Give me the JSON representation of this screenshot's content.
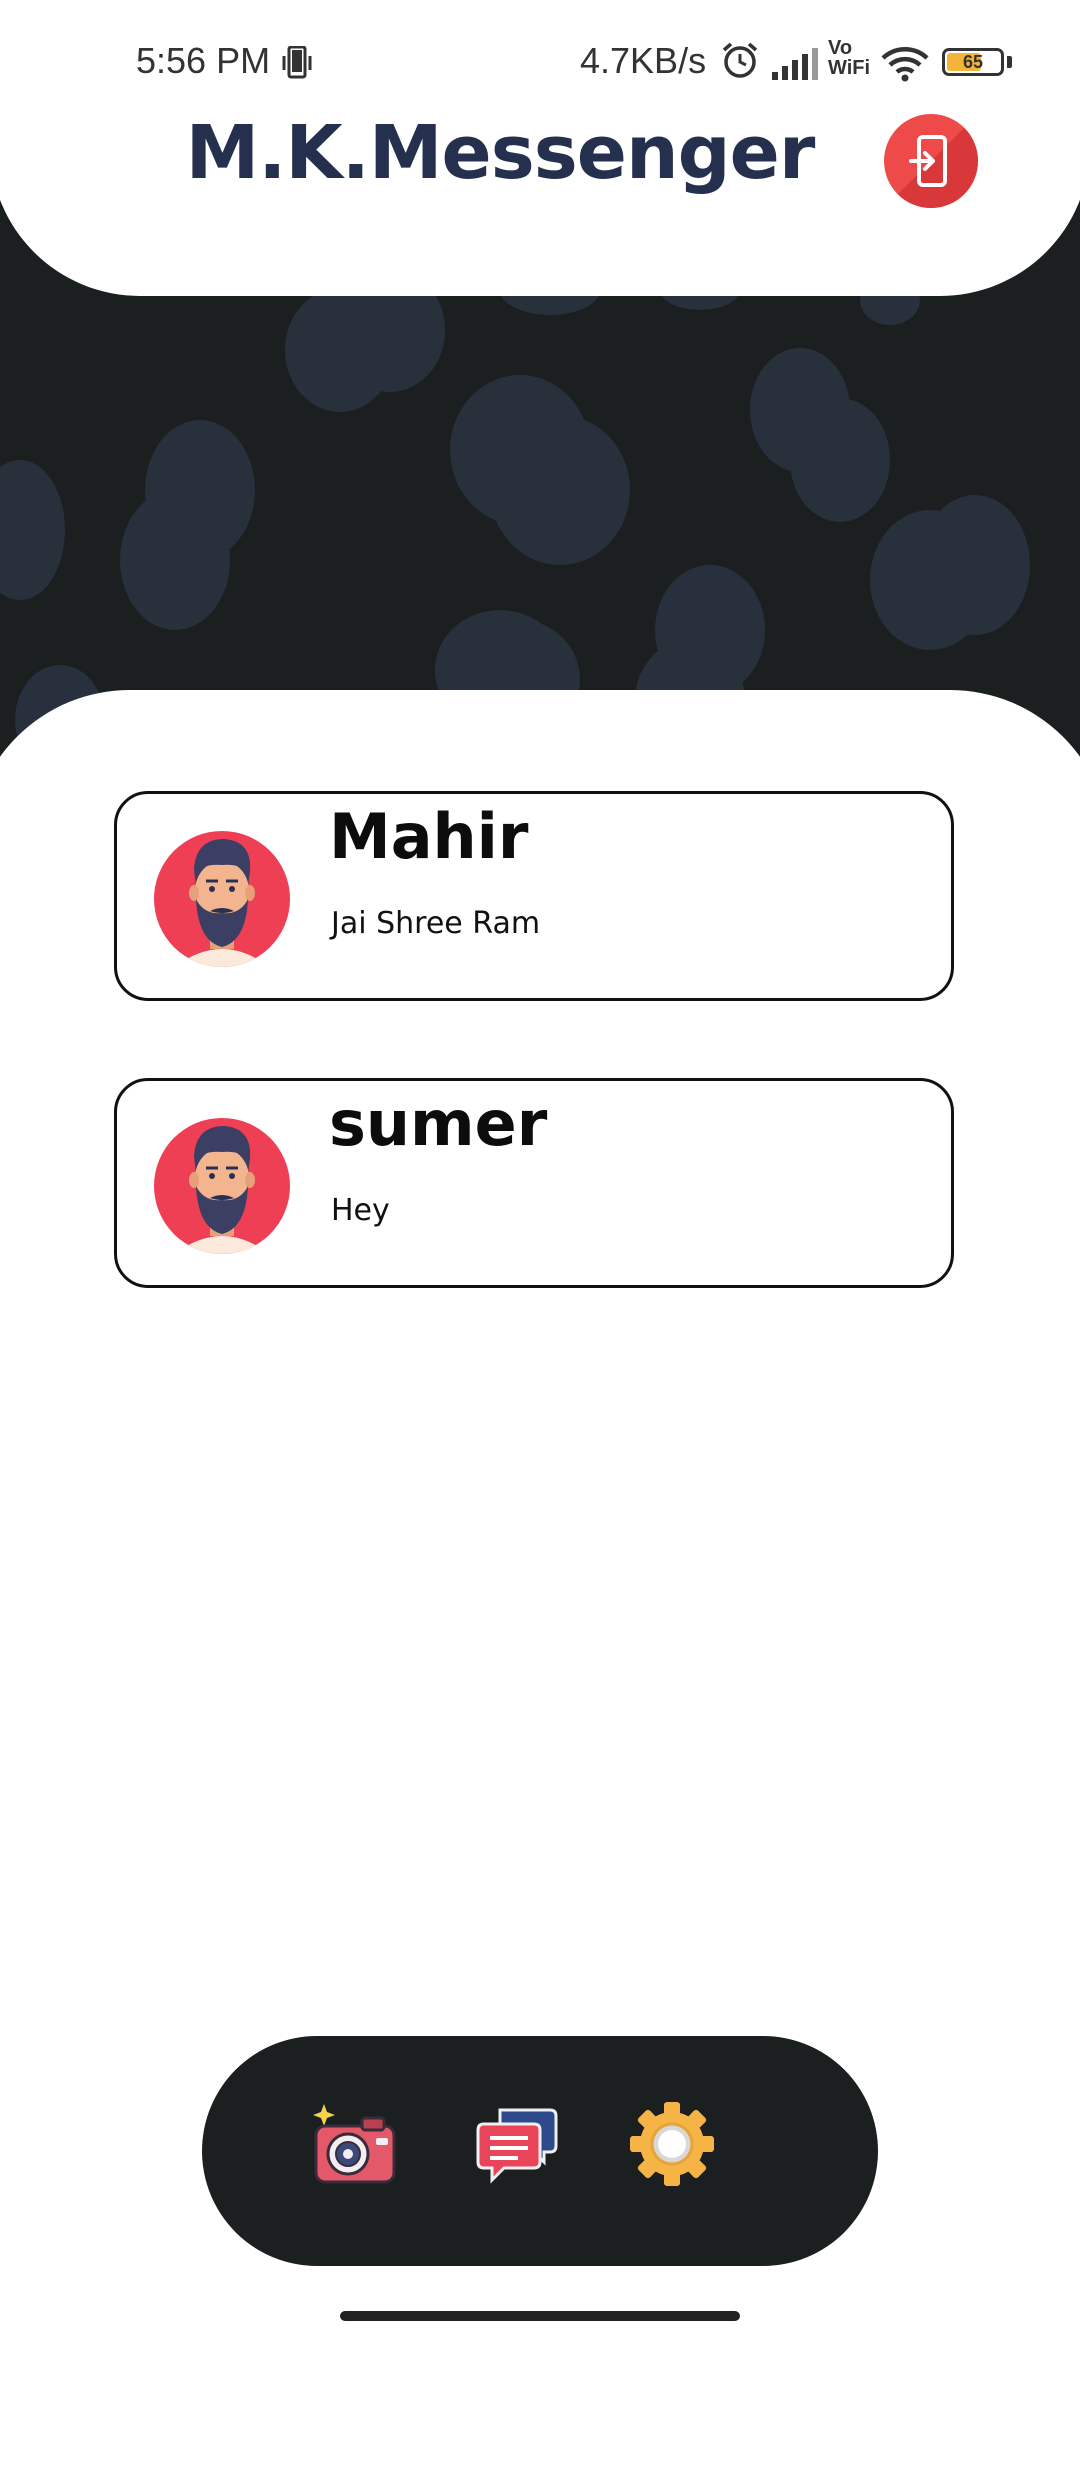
{
  "status_bar": {
    "time": "5:56 PM",
    "network_speed": "4.7KB/s",
    "vowifi_line1": "Vo",
    "vowifi_line2": "WiFi",
    "battery_level": "65",
    "icons": [
      "phone-vibrate-icon",
      "alarm-icon",
      "signal-icon",
      "wifi-icon",
      "battery-icon"
    ]
  },
  "header": {
    "title": "M.K.Messenger",
    "logout_icon": "logout-icon",
    "accent_color": "#ee4a4a",
    "title_color": "#24304d"
  },
  "contacts": [
    {
      "name": "Mahir",
      "last_message": "Jai Shree Ram",
      "avatar": "bearded-man-avatar"
    },
    {
      "name": "sumer",
      "last_message": "Hey",
      "avatar": "bearded-man-avatar"
    }
  ],
  "bottom_nav": {
    "items": [
      {
        "icon": "camera-icon"
      },
      {
        "icon": "chat-icon"
      },
      {
        "icon": "settings-gear-icon"
      }
    ]
  }
}
